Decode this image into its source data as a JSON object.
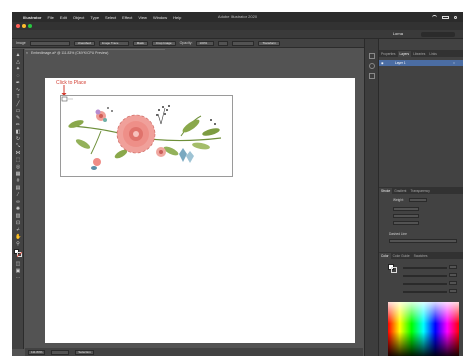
{
  "menubar": {
    "apple": "",
    "items": [
      "Illustrator",
      "File",
      "Edit",
      "Object",
      "Type",
      "Select",
      "Effect",
      "View",
      "Window",
      "Help"
    ],
    "window_title": "Adobe Illustrator 2020",
    "workspace": "Lorna"
  },
  "controlbar": {
    "object_type": "Image",
    "link_label": "Unembed",
    "image_trace": "Image Trace",
    "mask": "Mask",
    "crop_image": "Crop Image",
    "opacity_label": "Opacity:",
    "opacity_value": "100%",
    "transform": "Transform"
  },
  "document": {
    "tab_close": "×",
    "tab_title": "EmbedImage.ai* @ 111.83% (CMYK/CPU Preview)"
  },
  "canvas": {
    "annotation": "Click to Place"
  },
  "statusbar": {
    "zoom": "111.83%",
    "tool": "Selection"
  },
  "panels": {
    "top_tabs": [
      "Properties",
      "Layers",
      "Libraries",
      "Links"
    ],
    "active_top_tab": "Layers",
    "layer_name": "Layer 1",
    "stroke_tabs": [
      "Stroke",
      "Gradient",
      "Transparency"
    ],
    "stroke_weight_label": "Weight:",
    "dashed_line_label": "Dashed Line",
    "color_tabs": [
      "Color",
      "Color Guide",
      "Swatches"
    ]
  },
  "colors": {
    "annotation_red": "#d23b2f",
    "selection_blue": "#4b6da3",
    "canvas_gray": "#535353"
  },
  "icons": [
    "apple-icon",
    "selection-tool-icon",
    "direct-selection-icon",
    "pen-tool-icon",
    "type-tool-icon",
    "hand-tool-icon",
    "zoom-tool-icon",
    "fill-stroke-icon",
    "eye-icon"
  ]
}
